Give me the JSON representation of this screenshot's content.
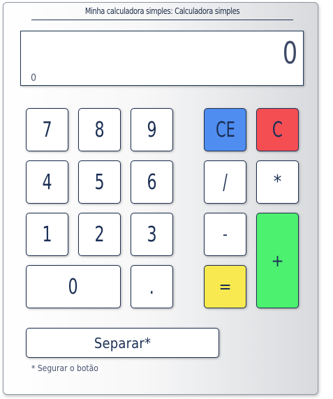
{
  "title": "Minha calculadora simples: Calculadora simples",
  "display": {
    "value": "0",
    "history": "0"
  },
  "keys": {
    "k7": "7",
    "k8": "8",
    "k9": "9",
    "k4": "4",
    "k5": "5",
    "k6": "6",
    "k1": "1",
    "k2": "2",
    "k3": "3",
    "k0": "0",
    "dot": ".",
    "ce": "CE",
    "c": "C",
    "divide": "/",
    "multiply": "*",
    "minus": "-",
    "plus": "+",
    "equals": "="
  },
  "split_button": "Separar*",
  "note": "* Segurar o botão",
  "colors": {
    "ce": "#4f8ef0",
    "c": "#f44e53",
    "plus": "#4cf16f",
    "equals": "#f7e94f",
    "text": "#1b2f55"
  }
}
